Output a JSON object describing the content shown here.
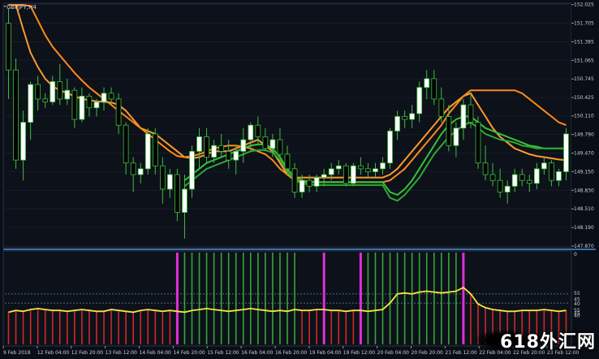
{
  "chart_data": [
    {
      "type": "candlestick",
      "title": "GBPJPY,H4",
      "ylim": [
        147.87,
        152.02
      ],
      "y_ticks": [
        "152.025",
        "151.705",
        "151.385",
        "151.065",
        "150.745",
        "150.425",
        "150.110",
        "149.790",
        "149.470",
        "149.150",
        "148.830",
        "148.510",
        "148.190",
        "147.870"
      ],
      "x_ticks": [
        "9 Feb 2018",
        "12 Feb 04:00",
        "12 Feb 20:00",
        "13 Feb 12:00",
        "14 Feb 04:00",
        "14 Feb 20:00",
        "15 Feb 12:00",
        "16 Feb 04:00",
        "16 Feb 20:00",
        "19 Feb 04:00",
        "19 Feb 12:00",
        "20 Feb 04:00",
        "20 Feb 20:00",
        "21 Feb 12:00",
        "22 Feb 04:00",
        "22 Feb 20:00",
        "23 Feb 12:00"
      ],
      "ohlc": [
        [
          151.7,
          151.95,
          150.4,
          150.9
        ],
        [
          150.9,
          151.1,
          149.2,
          149.35
        ],
        [
          149.35,
          150.2,
          149.0,
          150.0
        ],
        [
          150.0,
          150.7,
          149.7,
          150.65
        ],
        [
          150.65,
          150.8,
          150.2,
          150.4
        ],
        [
          150.4,
          150.5,
          150.25,
          150.35
        ],
        [
          150.35,
          150.8,
          150.3,
          150.7
        ],
        [
          150.7,
          151.0,
          150.3,
          150.4
        ],
        [
          150.4,
          150.75,
          150.3,
          150.55
        ],
        [
          150.55,
          150.6,
          149.9,
          150.05
        ],
        [
          150.05,
          150.6,
          150.0,
          150.45
        ],
        [
          150.45,
          150.5,
          150.1,
          150.25
        ],
        [
          150.25,
          150.4,
          150.1,
          150.35
        ],
        [
          150.35,
          150.6,
          150.2,
          150.5
        ],
        [
          150.5,
          150.6,
          150.3,
          150.4
        ],
        [
          150.4,
          150.5,
          149.8,
          149.95
        ],
        [
          149.95,
          150.0,
          149.1,
          149.3
        ],
        [
          149.3,
          149.4,
          148.8,
          149.1
        ],
        [
          149.1,
          149.3,
          148.95,
          149.2
        ],
        [
          149.2,
          149.9,
          149.1,
          149.8
        ],
        [
          149.8,
          149.9,
          149.1,
          149.25
        ],
        [
          149.25,
          149.4,
          148.6,
          148.85
        ],
        [
          148.85,
          149.2,
          148.7,
          149.1
        ],
        [
          149.1,
          149.2,
          148.3,
          148.45
        ],
        [
          148.45,
          149.1,
          148.0,
          148.85
        ],
        [
          148.85,
          149.6,
          148.7,
          149.5
        ],
        [
          149.5,
          149.9,
          149.2,
          149.75
        ],
        [
          149.75,
          149.9,
          149.3,
          149.4
        ],
        [
          149.4,
          149.7,
          149.3,
          149.6
        ],
        [
          149.6,
          149.8,
          149.4,
          149.5
        ],
        [
          149.5,
          149.7,
          149.2,
          149.35
        ],
        [
          149.35,
          149.6,
          149.1,
          149.5
        ],
        [
          149.5,
          149.9,
          149.3,
          149.7
        ],
        [
          149.7,
          150.0,
          149.5,
          149.95
        ],
        [
          149.95,
          150.1,
          149.6,
          149.75
        ],
        [
          149.75,
          149.9,
          149.5,
          149.55
        ],
        [
          149.55,
          149.8,
          149.4,
          149.7
        ],
        [
          149.7,
          149.9,
          149.4,
          149.45
        ],
        [
          149.45,
          149.6,
          149.1,
          149.2
        ],
        [
          149.2,
          149.3,
          148.7,
          148.8
        ],
        [
          148.8,
          149.1,
          148.7,
          149.0
        ],
        [
          149.0,
          149.1,
          148.8,
          148.9
        ],
        [
          148.9,
          149.1,
          148.8,
          149.05
        ],
        [
          149.05,
          149.2,
          148.9,
          149.1
        ],
        [
          149.1,
          149.3,
          149.0,
          149.2
        ],
        [
          149.2,
          149.35,
          149.1,
          149.25
        ],
        [
          149.25,
          149.3,
          148.9,
          148.95
        ],
        [
          148.95,
          149.3,
          148.9,
          149.25
        ],
        [
          149.25,
          149.4,
          149.1,
          149.2
        ],
        [
          149.2,
          149.3,
          149.05,
          149.15
        ],
        [
          149.15,
          149.3,
          149.05,
          149.2
        ],
        [
          149.2,
          149.4,
          149.1,
          149.3
        ],
        [
          149.3,
          149.9,
          149.2,
          149.85
        ],
        [
          149.85,
          150.2,
          149.7,
          150.1
        ],
        [
          150.1,
          150.2,
          149.9,
          150.05
        ],
        [
          150.05,
          150.3,
          149.9,
          150.15
        ],
        [
          150.15,
          150.7,
          150.0,
          150.6
        ],
        [
          150.6,
          150.9,
          150.4,
          150.75
        ],
        [
          150.75,
          150.9,
          150.3,
          150.4
        ],
        [
          150.4,
          150.6,
          150.0,
          150.1
        ],
        [
          150.1,
          150.3,
          149.5,
          149.6
        ],
        [
          149.6,
          150.0,
          149.4,
          149.9
        ],
        [
          149.9,
          150.4,
          149.7,
          150.3
        ],
        [
          150.3,
          150.5,
          149.9,
          150.0
        ],
        [
          150.0,
          150.1,
          149.2,
          149.3
        ],
        [
          149.3,
          149.6,
          149.0,
          149.1
        ],
        [
          149.1,
          149.3,
          148.9,
          149.0
        ],
        [
          149.0,
          149.2,
          148.7,
          148.8
        ],
        [
          148.8,
          149.0,
          148.6,
          148.9
        ],
        [
          148.9,
          149.2,
          148.8,
          149.1
        ],
        [
          149.1,
          149.2,
          148.9,
          149.0
        ],
        [
          149.0,
          149.1,
          148.8,
          148.95
        ],
        [
          148.95,
          149.3,
          148.85,
          149.2
        ],
        [
          149.2,
          149.4,
          149.1,
          149.3
        ],
        [
          149.3,
          149.35,
          148.9,
          149.0
        ],
        [
          149.0,
          149.2,
          148.9,
          149.15
        ],
        [
          149.15,
          149.9,
          149.0,
          149.8
        ]
      ],
      "series": [
        {
          "role": "fast_orange",
          "color": "#ff9a2e",
          "values": [
            152.6,
            152.1,
            151.6,
            151.2,
            150.95,
            150.75,
            150.62,
            150.55,
            150.5,
            150.45,
            150.4,
            150.38,
            150.36,
            150.35,
            150.34,
            150.3,
            150.2,
            150.05,
            149.9,
            149.85,
            149.8,
            149.7,
            149.6,
            149.5,
            149.4,
            149.38,
            149.4,
            149.45,
            149.5,
            149.5,
            149.5,
            149.55,
            149.6,
            149.65,
            149.7,
            149.6,
            149.5,
            149.3,
            149.1,
            149.05,
            149.05,
            149.05,
            149.05,
            149.05,
            149.05,
            149.05,
            149.05,
            149.05,
            149.05,
            149.05,
            149.05,
            149.05,
            149.1,
            149.2,
            149.35,
            149.5,
            149.65,
            149.8,
            149.95,
            150.1,
            150.25,
            150.35,
            150.45,
            150.5,
            150.3,
            150.1,
            149.9,
            149.75,
            149.65,
            149.55,
            149.5,
            149.45,
            149.42,
            149.4,
            149.38,
            149.36,
            149.35
          ]
        },
        {
          "role": "slow_orange",
          "color": "#ff8a1a",
          "values": [
            152.9,
            152.6,
            152.3,
            152.0,
            151.75,
            151.5,
            151.3,
            151.15,
            151.0,
            150.85,
            150.72,
            150.6,
            150.5,
            150.4,
            150.3,
            150.2,
            150.1,
            150.0,
            149.9,
            149.8,
            149.7,
            149.6,
            149.5,
            149.42,
            149.4,
            149.42,
            149.45,
            149.5,
            149.55,
            149.58,
            149.6,
            149.6,
            149.58,
            149.55,
            149.5,
            149.45,
            149.35,
            149.2,
            149.1,
            149.0,
            148.98,
            148.97,
            148.97,
            148.97,
            148.97,
            148.97,
            148.97,
            148.97,
            148.97,
            148.97,
            148.97,
            148.97,
            149.0,
            149.1,
            149.2,
            149.35,
            149.5,
            149.65,
            149.8,
            149.95,
            150.15,
            150.3,
            150.45,
            150.55,
            150.55,
            150.55,
            150.55,
            150.55,
            150.55,
            150.55,
            150.5,
            150.4,
            150.3,
            150.2,
            150.1,
            150.0,
            149.95
          ]
        },
        {
          "role": "fast_green",
          "color": "#36c23a",
          "values": [
            null,
            null,
            null,
            null,
            null,
            null,
            null,
            null,
            null,
            null,
            null,
            null,
            null,
            null,
            null,
            null,
            null,
            null,
            null,
            null,
            null,
            null,
            null,
            null,
            149.0,
            149.1,
            149.2,
            149.3,
            149.35,
            149.4,
            149.45,
            149.5,
            149.55,
            149.6,
            149.62,
            149.62,
            149.55,
            149.4,
            149.2,
            149.05,
            149.0,
            148.98,
            148.97,
            148.97,
            148.97,
            148.97,
            148.97,
            148.97,
            148.97,
            148.97,
            148.97,
            148.97,
            148.8,
            148.75,
            148.85,
            149.0,
            149.2,
            149.4,
            149.6,
            149.8,
            149.95,
            150.05,
            150.1,
            150.1,
            150.0,
            149.9,
            149.85,
            149.8,
            149.75,
            149.7,
            149.65,
            149.6,
            149.58,
            149.55,
            149.55,
            149.55,
            149.55
          ]
        },
        {
          "role": "slow_green",
          "color": "#2ea832",
          "values": [
            null,
            null,
            null,
            null,
            null,
            null,
            null,
            null,
            null,
            null,
            null,
            null,
            null,
            null,
            null,
            null,
            null,
            null,
            null,
            null,
            null,
            null,
            null,
            null,
            148.9,
            149.0,
            149.1,
            149.2,
            149.25,
            149.3,
            149.35,
            149.4,
            149.45,
            149.5,
            149.52,
            149.52,
            149.48,
            149.35,
            149.15,
            149.0,
            148.95,
            148.93,
            148.92,
            148.92,
            148.92,
            148.92,
            148.92,
            148.92,
            148.92,
            148.92,
            148.92,
            148.92,
            148.7,
            148.65,
            148.75,
            148.9,
            149.05,
            149.25,
            149.45,
            149.6,
            149.75,
            149.85,
            149.95,
            150.0,
            149.9,
            149.8,
            149.75,
            149.7,
            149.68,
            149.65,
            149.6,
            149.58,
            149.55,
            149.55,
            149.55,
            149.55,
            149.55
          ]
        }
      ]
    },
    {
      "type": "bar",
      "title": "",
      "ylim": [
        0,
        100
      ],
      "y_ticks": [
        "0",
        "55",
        "45",
        "40",
        "55",
        "45",
        "40"
      ],
      "line_color": "#f2e640",
      "bar_colors": {
        "up": "#3fbe3f",
        "down": "#cc2a2a",
        "signal": "#e030d8"
      },
      "line": [
        35,
        37,
        36,
        38,
        39,
        38,
        37,
        37,
        36,
        37,
        38,
        37,
        36,
        36,
        38,
        37,
        36,
        35,
        37,
        38,
        37,
        36,
        37,
        36,
        35,
        37,
        38,
        39,
        38,
        37,
        36,
        37,
        38,
        39,
        38,
        37,
        36,
        37,
        36,
        38,
        37,
        37,
        38,
        38,
        37,
        37,
        36,
        37,
        37,
        36,
        37,
        38,
        45,
        55,
        56,
        55,
        57,
        58,
        57,
        56,
        57,
        58,
        62,
        55,
        44,
        40,
        38,
        37,
        36,
        36,
        37,
        37,
        37,
        38,
        37,
        36,
        37
      ],
      "bars": [
        "down",
        "down",
        "down",
        "down",
        "down",
        "down",
        "down",
        "down",
        "down",
        "down",
        "down",
        "down",
        "down",
        "down",
        "down",
        "down",
        "down",
        "down",
        "down",
        "down",
        "down",
        "down",
        "down",
        "signal",
        "up",
        "up",
        "up",
        "up",
        "up",
        "up",
        "up",
        "up",
        "up",
        "up",
        "up",
        "up",
        "up",
        "up",
        "up",
        "up",
        "down",
        "down",
        "down",
        "signal",
        "down",
        "down",
        "down",
        "down",
        "signal",
        "up",
        "up",
        "up",
        "up",
        "up",
        "up",
        "up",
        "up",
        "up",
        "up",
        "up",
        "up",
        "up",
        "signal",
        "down",
        "down",
        "down",
        "down",
        "down",
        "down",
        "down",
        "down",
        "down",
        "down",
        "down",
        "down",
        "down",
        "down"
      ]
    }
  ],
  "watermark": "618外汇网"
}
